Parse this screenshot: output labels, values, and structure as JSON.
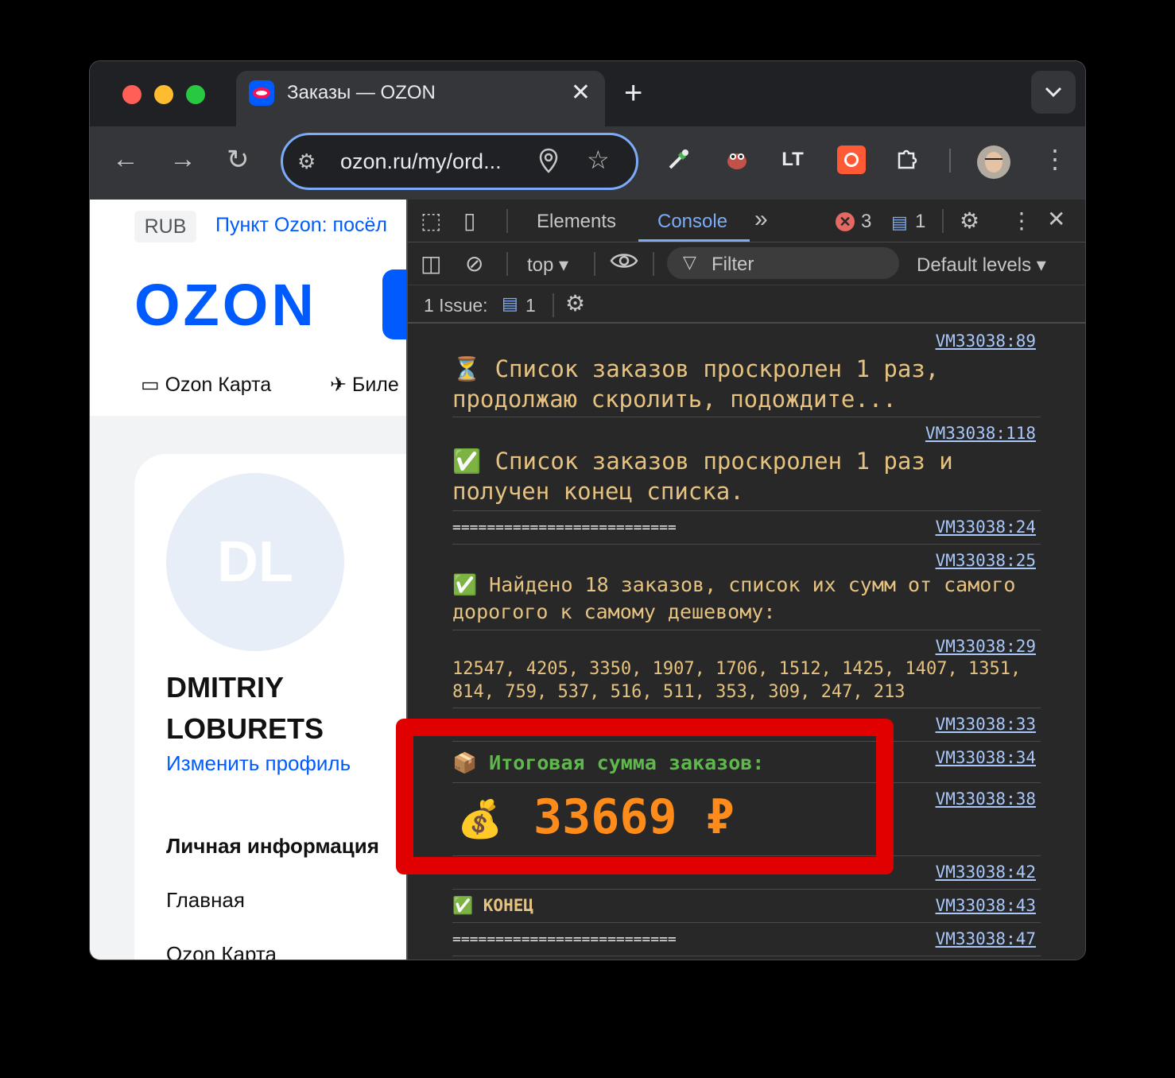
{
  "browser": {
    "tab_title": "Заказы — OZON",
    "tab_close": "✕",
    "new_tab": "+",
    "tab_search": "⌄",
    "url": "ozon.ru/my/ord...",
    "extensions": [
      "eyedropper-icon",
      "frog-icon",
      "lt-icon",
      "record-icon",
      "puzzle-icon"
    ],
    "lt_label": "LT"
  },
  "page": {
    "currency": "RUB",
    "pickup_link": "Пункт Ozon: посёл",
    "logo": "OZON",
    "nav_card": "Ozon Карта",
    "nav_tickets": "Биле",
    "avatar_initials": "DL",
    "user_name": "DMITRIY LOBURETS",
    "edit_profile": "Изменить профиль",
    "menu_heading": "Личная информация",
    "menu_home": "Главная",
    "menu_card": "Ozon Карта"
  },
  "devtools": {
    "tabs": [
      "Elements",
      "Console"
    ],
    "active_tab": "Console",
    "more_tabs": "»",
    "error_count": "3",
    "message_count": "1",
    "context": "top ▾",
    "filter_placeholder": "Filter",
    "levels": "Default levels ▾",
    "issues_label": "1 Issue:",
    "issues_count": "1"
  },
  "console": {
    "m1_src": "VM33038:89",
    "m1_text": "⏳ Список заказов проскролен 1 раз, продолжаю скролить, подождите...",
    "m2_src": "VM33038:118",
    "m2_text": "✅ Список заказов проскролен 1 раз и получен конец списка.",
    "m3_src": "VM33038:24",
    "m3_text": "==========================",
    "m4_src": "VM33038:25",
    "m4_text": "✅ Найдено 18 заказов, список их сумм от самого дорогого к самому дешевому:",
    "m5_src": "VM33038:29",
    "m5_text": "12547, 4205, 3350, 1907, 1706, 1512, 1425, 1407, 1351, 814, 759, 537, 516, 511, 353, 309, 247, 213",
    "m6_src": "VM33038:33",
    "m7_src": "VM33038:34",
    "m7_text": "📦 Итоговая сумма заказов:",
    "m8_src": "VM33038:38",
    "m8_icon": "💰",
    "m8_text": "33669 ₽",
    "m9_src": "VM33038:42",
    "m9_text": "==========================",
    "m10_src": "VM33038:43",
    "m10_text": "✅ КОНЕЦ",
    "m11_src": "VM33038:47",
    "m11_text": "=========================="
  },
  "colors": {
    "ozon_blue": "#005bff",
    "highlight_red": "#e00000",
    "total_orange": "#ff8c1a",
    "console_yellow": "#e6c280",
    "console_green": "#5fb84c"
  }
}
